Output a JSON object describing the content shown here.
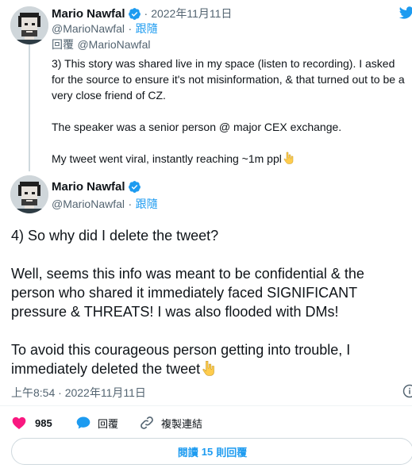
{
  "reply": {
    "author_name": "Mario Nawfal",
    "timestamp": "2022年11月11日",
    "handle": "@MarioNawfal",
    "follow_label": "跟隨",
    "replying_to_label": "回覆",
    "replying_to_handle": "@MarioNawfal",
    "paragraphs": [
      "3) This story was shared live in my space (listen to recording). I asked for the source to ensure it's not misinformation, & that turned out to be a very close friend of CZ.",
      "The speaker was a senior person @ major CEX exchange.",
      "My tweet went viral, instantly reaching ~1m ppl"
    ]
  },
  "tweet": {
    "author_name": "Mario Nawfal",
    "handle": "@MarioNawfal",
    "follow_label": "跟隨",
    "paragraphs": [
      "4) So why did I delete the tweet?",
      "Well, seems this info was meant to be confidential & the person who shared it immediately faced SIGNIFICANT pressure & THREATS! I was also flooded with DMs!",
      "To avoid this courageous person getting into trouble, I immediately deleted the tweet"
    ],
    "timestamp": "上午8:54 · 2022年11月11日"
  },
  "actions": {
    "like_count": "985",
    "reply_label": "回覆",
    "copy_link_label": "複製連結"
  },
  "read_replies": {
    "prefix": "閱讀",
    "count": "15",
    "suffix": "則回覆"
  },
  "icons": {
    "brand": "twitter-bird-icon",
    "verified": "verified-badge-icon",
    "like": "heart-icon",
    "reply": "comment-icon",
    "copy_link": "link-icon",
    "info": "info-icon",
    "emoji": "backhand-index-pointing-down-emoji"
  },
  "colors": {
    "accent": "#1d9bf0",
    "like": "#f91880",
    "muted": "#536471",
    "border": "#cfd9de"
  }
}
